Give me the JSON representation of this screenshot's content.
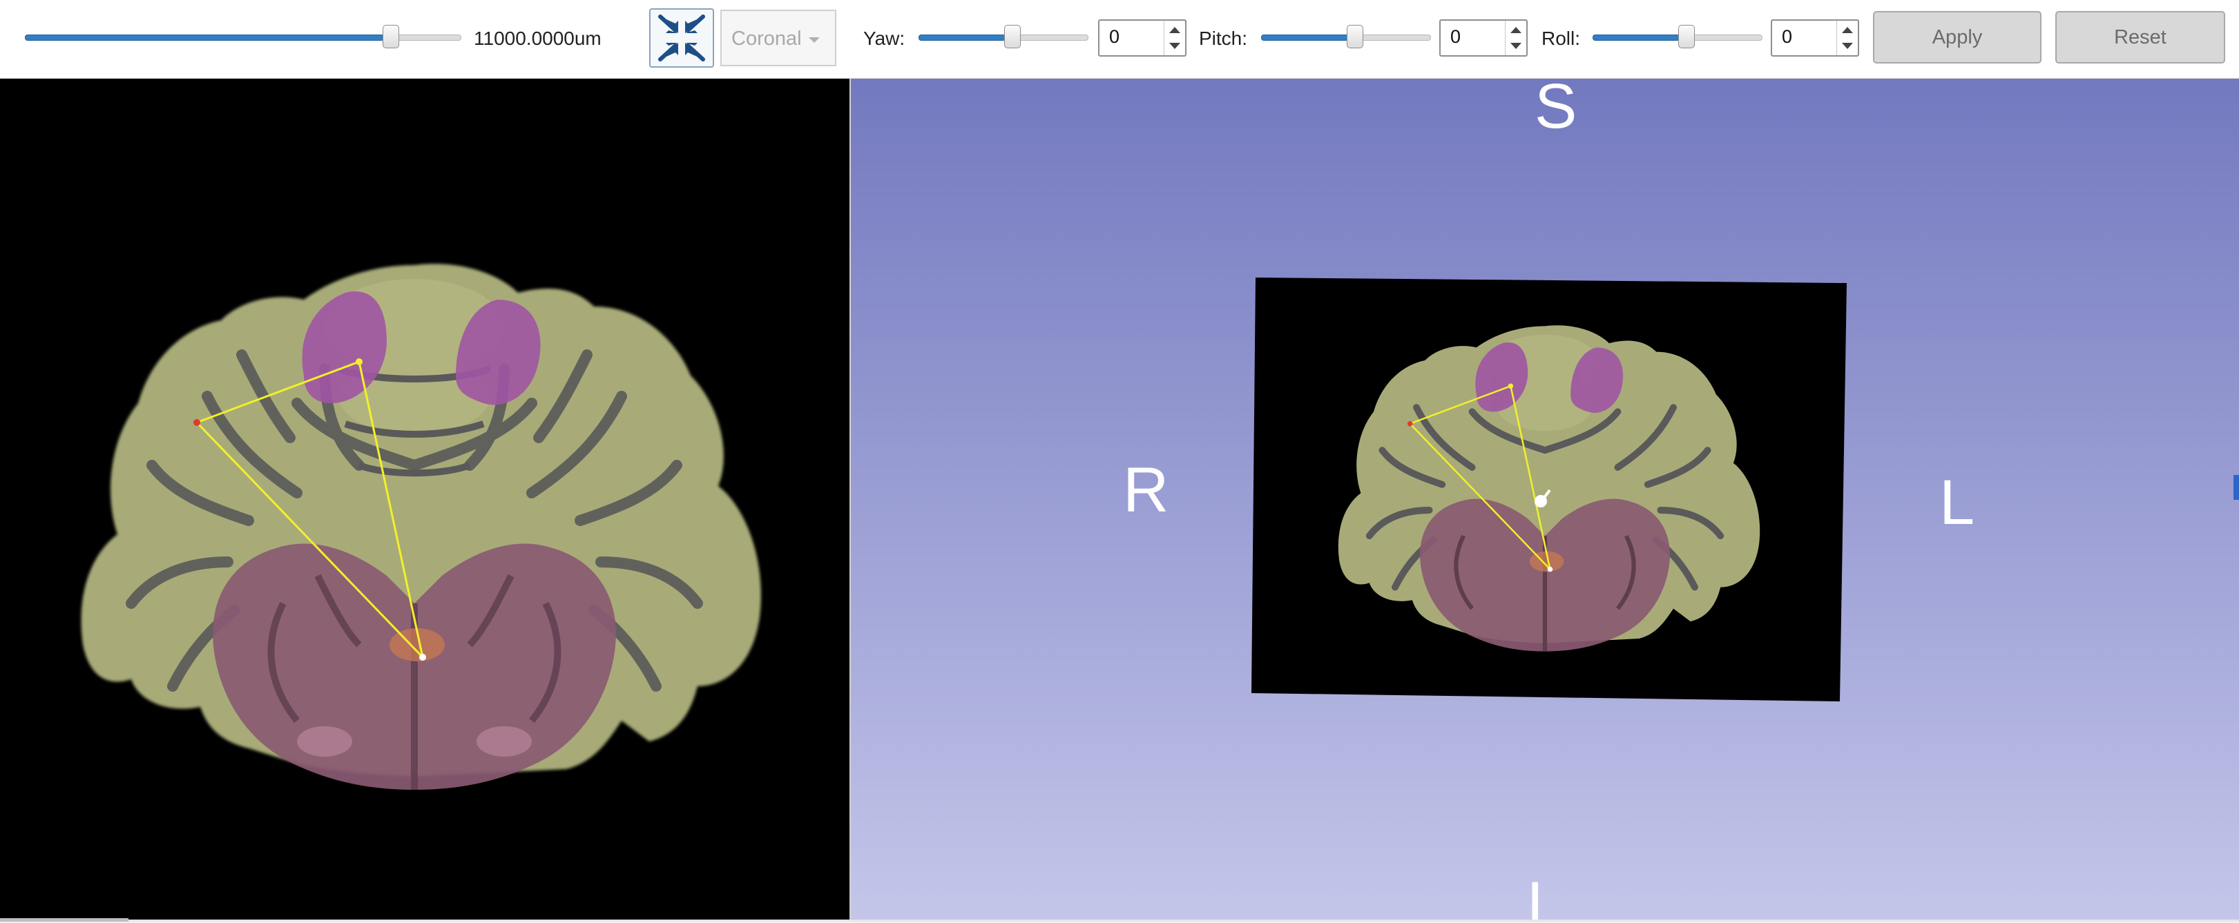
{
  "toolbar": {
    "slice_offset": {
      "value": 0.82,
      "readout": "11000.0000um"
    },
    "fit_button_icon": "shrink-arrows-icon",
    "orientation_select": {
      "selected": "Coronal"
    },
    "yaw": {
      "label": "Yaw:",
      "value": "0",
      "slider": 0.5
    },
    "pitch": {
      "label": "Pitch:",
      "value": "0",
      "slider": 0.5
    },
    "roll": {
      "label": "Roll:",
      "value": "0",
      "slider": 0.5
    },
    "apply_label": "Apply",
    "reset_label": "Reset"
  },
  "view3d": {
    "orientation_labels": {
      "superior": "S",
      "right": "R",
      "left": "L",
      "inferior": "I"
    }
  },
  "colors": {
    "toolbar_bg": "#ffffff",
    "slider_fill": "#2f7fc7",
    "view3d_gradient_top": "#7379bf",
    "view3d_gradient_bottom": "#c4c6e9",
    "cerebellum_cortex": "#a8ab78",
    "white_matter": "#555555",
    "brainstem": "#8a5a72",
    "highlight_region": "#a055a3",
    "annotation_lines": "#f3f02a"
  }
}
